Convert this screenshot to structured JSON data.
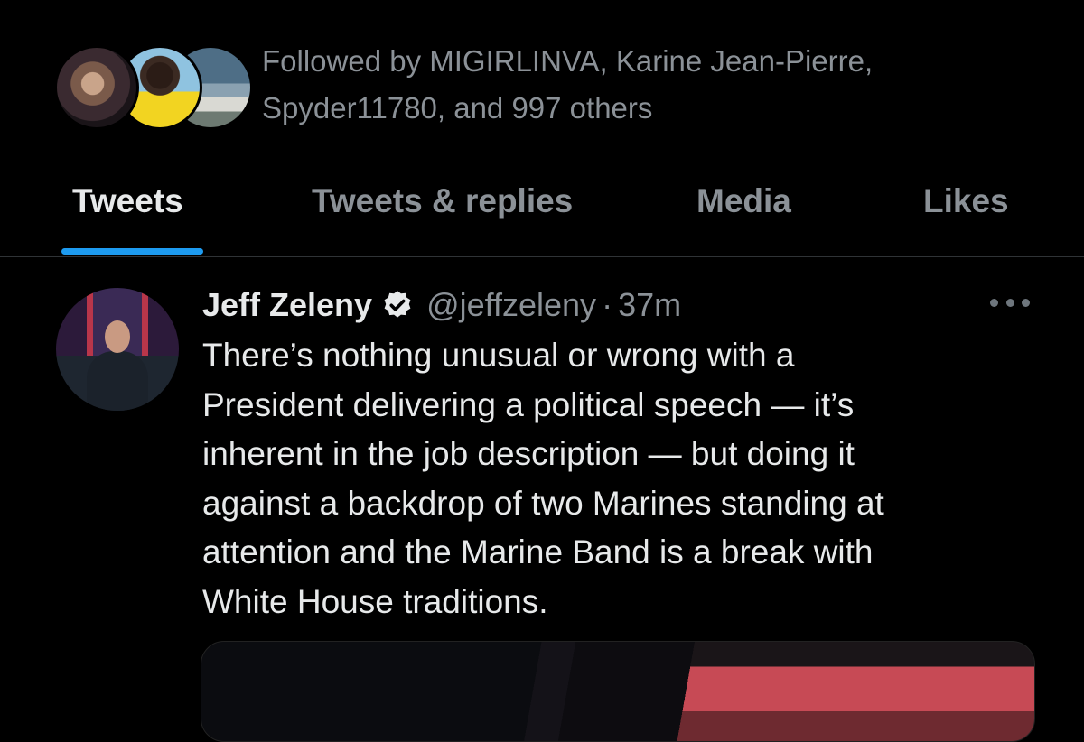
{
  "followers": {
    "text_line1": "Followed by MIGIRLINVA, Karine Jean-Pierre,",
    "text_line2": "Spyder11780, and 997 others"
  },
  "tabs": [
    {
      "label": "Tweets",
      "active": true
    },
    {
      "label": "Tweets & replies",
      "active": false
    },
    {
      "label": "Media",
      "active": false
    },
    {
      "label": "Likes",
      "active": false
    }
  ],
  "tweet": {
    "author_name": "Jeff Zeleny",
    "verified": true,
    "handle": "@jeffzeleny",
    "separator": "·",
    "time": "37m",
    "lines": [
      "There’s nothing unusual or wrong with a",
      "President delivering a political speech — it’s",
      "inherent in the job description — but doing it",
      "against a backdrop of two Marines standing at",
      "attention and the Marine Band is a break with",
      "White House traditions."
    ],
    "more_icon": "ellipsis-icon"
  },
  "colors": {
    "background": "#000000",
    "accent": "#1d9bf0",
    "muted_text": "#8b9197",
    "primary_text": "#e7e9ea"
  }
}
